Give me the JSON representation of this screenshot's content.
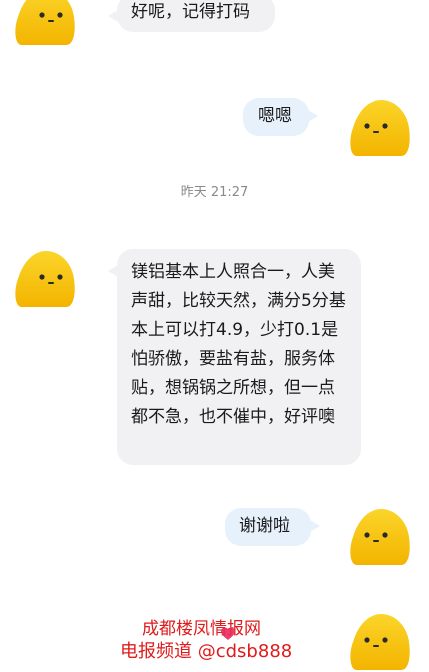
{
  "chat": {
    "messages": [
      {
        "side": "left",
        "text": "好呢，记得打码"
      },
      {
        "side": "right",
        "text": "嗯嗯"
      },
      {
        "side": "left",
        "text": "镁铝基本上人照合一，人美声甜，比较天然，满分5分基本上可以打4.9，少打0.1是怕骄傲，要盐有盐，服务体贴，想锅锅之所想，但一点都不急，也不催中，好评噢"
      },
      {
        "side": "right",
        "text": "谢谢啦"
      }
    ],
    "timestamp": "昨天 21:27"
  },
  "watermark": {
    "line1": "成都楼凤情报网",
    "line2_prefix": "电报频道 ",
    "line2_handle": "@cdsb888"
  },
  "colors": {
    "avatar": "#f7c816",
    "left_bubble": "#f1f1f3",
    "right_bubble": "#e6f1fb",
    "watermark_text": "#e01b1b"
  },
  "icons": {
    "avatar": "yellow-blob-avatar-icon",
    "watermark": "heart-icon"
  }
}
